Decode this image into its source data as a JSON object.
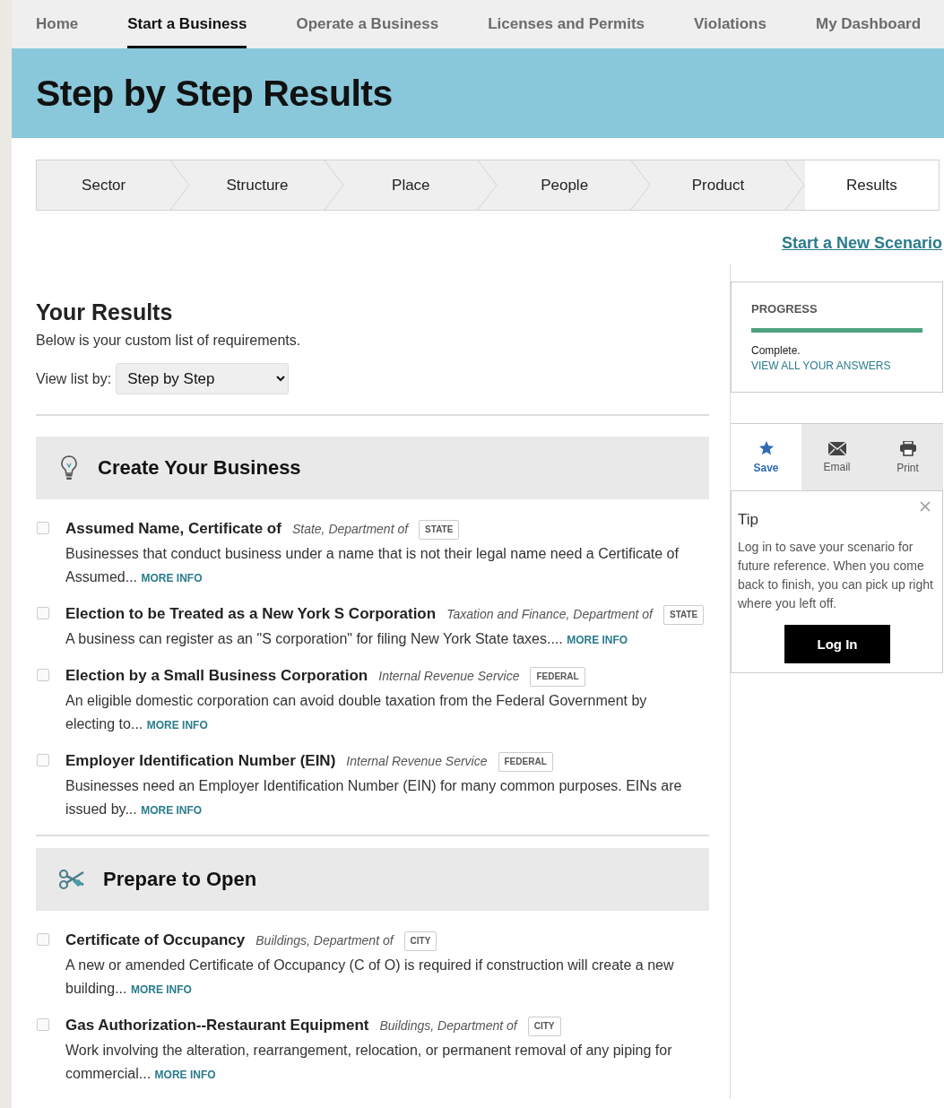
{
  "nav": [
    {
      "label": "Home",
      "selected": false
    },
    {
      "label": "Start a Business",
      "selected": true
    },
    {
      "label": "Operate a Business",
      "selected": false
    },
    {
      "label": "Licenses and Permits",
      "selected": false
    },
    {
      "label": "Violations",
      "selected": false
    },
    {
      "label": "My Dashboard",
      "selected": false
    }
  ],
  "page_title": "Step by Step Results",
  "steps": [
    {
      "label": "Sector",
      "selected": false
    },
    {
      "label": "Structure",
      "selected": false
    },
    {
      "label": "Place",
      "selected": false
    },
    {
      "label": "People",
      "selected": false
    },
    {
      "label": "Product",
      "selected": false
    },
    {
      "label": "Results",
      "selected": true
    }
  ],
  "new_scenario_link": "Start a New Scenario",
  "results": {
    "heading": "Your Results",
    "intro": "Below is your custom list of requirements.",
    "view_label": "View list by:",
    "view_value": "Step by Step"
  },
  "sections": [
    {
      "title": "Create Your Business",
      "kind": "lightbulb",
      "items": [
        {
          "title": "Assumed Name, Certificate of",
          "agency": "State, Department of",
          "level": "STATE",
          "description": "Businesses that conduct business under a name that is not their legal name need a Certificate of Assumed...",
          "link": "MORE INFO",
          "checked": false
        },
        {
          "title": "Election to be Treated as a New York S Corporation",
          "agency": "Taxation and Finance, Department of",
          "level": "STATE",
          "description": "A business can register as an \"S corporation\" for filing New York State taxes....",
          "link": "MORE INFO",
          "checked": false
        },
        {
          "title": "Election by a Small Business Corporation",
          "agency": "Internal Revenue Service",
          "level": "FEDERAL",
          "description": "An eligible domestic corporation can avoid double taxation from the Federal Government by electing to...",
          "link": "MORE INFO",
          "checked": false
        },
        {
          "title": "Employer Identification Number (EIN)",
          "agency": "Internal Revenue Service",
          "level": "FEDERAL",
          "description": "Businesses need an Employer Identification Number (EIN) for many common purposes. EINs are issued by...",
          "link": "MORE INFO",
          "checked": false
        }
      ]
    },
    {
      "title": "Prepare to Open",
      "kind": "scissors",
      "items": [
        {
          "title": "Certificate of Occupancy",
          "agency": "Buildings, Department of",
          "level": "CITY",
          "description": "A new or amended Certificate of Occupancy (C of O) is required if construction will create a new building...",
          "link": "MORE INFO",
          "checked": false
        },
        {
          "title": "Gas Authorization--Restaurant Equipment",
          "agency": "Buildings, Department of",
          "level": "CITY",
          "description": "Work involving the alteration, rearrangement, relocation, or permanent removal of any piping for commercial...",
          "link": "MORE INFO",
          "checked": false
        }
      ]
    }
  ],
  "progress": {
    "label": "PROGRESS",
    "level": 1,
    "status": "Complete.",
    "link": "VIEW ALL YOUR ANSWERS"
  },
  "actions": [
    {
      "label": "Save",
      "kind": "star",
      "selected": true
    },
    {
      "label": "Email",
      "kind": "envelope",
      "selected": false
    },
    {
      "label": "Print",
      "kind": "printer",
      "selected": false
    }
  ],
  "tip": {
    "title": "Tip",
    "text": "Log in to save your scenario for future reference. When you come back to finish, you can pick up right where you left off.",
    "button": "Log In"
  }
}
